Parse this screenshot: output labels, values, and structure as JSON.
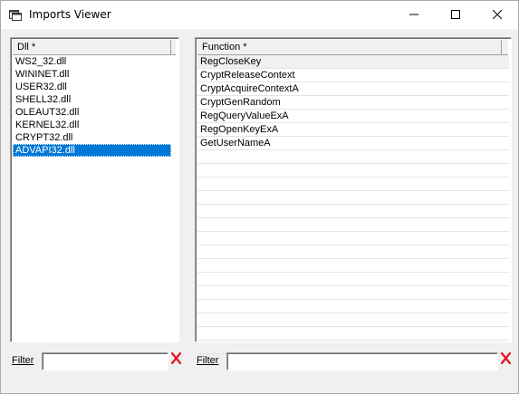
{
  "window": {
    "title": "Imports Viewer",
    "icon": "app-window-icon",
    "controls": {
      "minimize_icon": "minimize-icon",
      "maximize_icon": "maximize-icon",
      "close_icon": "close-icon"
    }
  },
  "dll_list": {
    "header": "Dll *",
    "items": [
      {
        "label": "WS2_32.dll",
        "selected": false
      },
      {
        "label": "WININET.dll",
        "selected": false
      },
      {
        "label": "USER32.dll",
        "selected": false
      },
      {
        "label": "SHELL32.dll",
        "selected": false
      },
      {
        "label": "OLEAUT32.dll",
        "selected": false
      },
      {
        "label": "KERNEL32.dll",
        "selected": false
      },
      {
        "label": "CRYPT32.dll",
        "selected": false
      },
      {
        "label": "ADVAPI32.dll",
        "selected": true
      }
    ]
  },
  "function_list": {
    "header": "Function *",
    "items": [
      {
        "label": "RegCloseKey",
        "focused": true
      },
      {
        "label": "CryptReleaseContext",
        "focused": false
      },
      {
        "label": "CryptAcquireContextA",
        "focused": false
      },
      {
        "label": "CryptGenRandom",
        "focused": false
      },
      {
        "label": "RegQueryValueExA",
        "focused": false
      },
      {
        "label": "RegOpenKeyExA",
        "focused": false
      },
      {
        "label": "GetUserNameA",
        "focused": false
      }
    ]
  },
  "filters": {
    "left": {
      "label": "Filter",
      "value": "",
      "clear_icon": "clear-x-icon"
    },
    "right": {
      "label": "Filter",
      "value": "",
      "clear_icon": "clear-x-icon"
    }
  },
  "colors": {
    "selection": "#0078d7",
    "clear_x": "#e81123"
  }
}
